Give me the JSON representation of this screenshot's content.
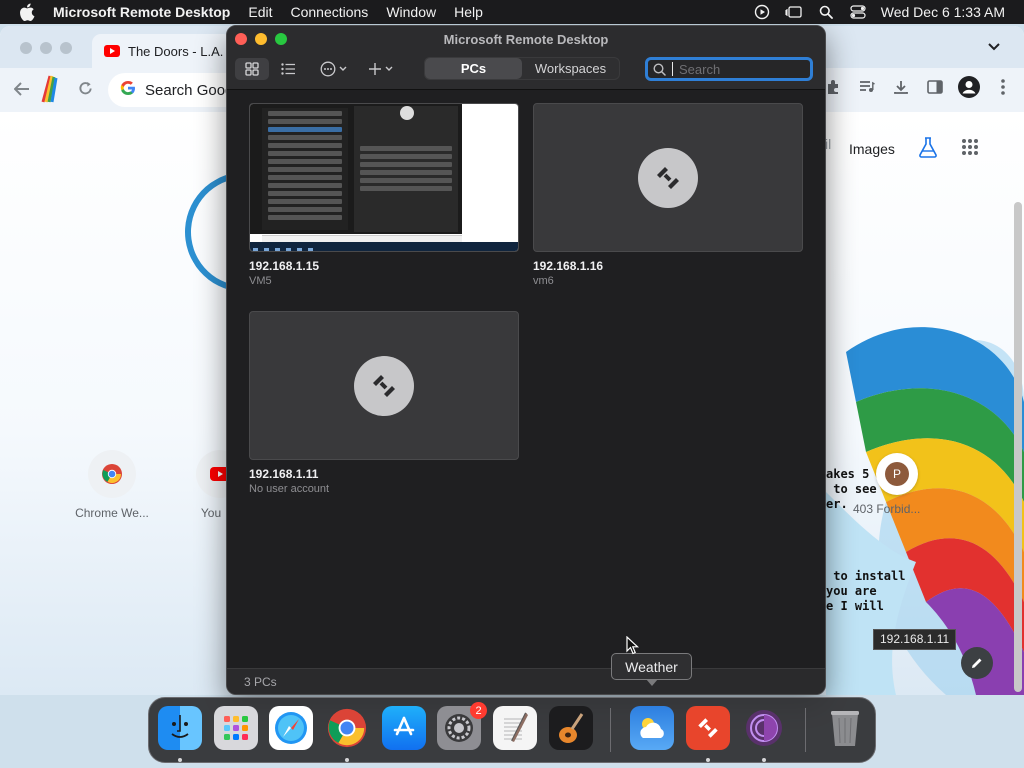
{
  "menubar": {
    "app_name": "Microsoft Remote Desktop",
    "menus": [
      "Edit",
      "Connections",
      "Window",
      "Help"
    ],
    "clock": "Wed Dec 6  1:33 AM"
  },
  "chrome": {
    "tab_title": "The Doors - L.A.",
    "omnibox_placeholder": "Search Goog",
    "links": {
      "faded": "il",
      "images": "Images"
    },
    "shortcuts": [
      {
        "label": "Chrome We..."
      },
      {
        "label": "You"
      }
    ],
    "overlay_text_1": "akes 5 hours\n to see\ner.",
    "overlay_text_2": " to install\nyou are\ne I will",
    "avatar_letter": "P",
    "forbidden_label": "403 Forbid...",
    "tooltip_ip": "192.168.1.11"
  },
  "rdwin": {
    "title": "Microsoft Remote Desktop",
    "tabs": {
      "pcs": "PCs",
      "workspaces": "Workspaces"
    },
    "search_placeholder": "Search",
    "pcs": [
      {
        "name": "192.168.1.15",
        "user": "VM5"
      },
      {
        "name": "192.168.1.16",
        "user": "vm6"
      },
      {
        "name": "192.168.1.11",
        "user": "No user account"
      }
    ],
    "footer_count": "3 PCs"
  },
  "weather_tooltip": "Weather",
  "dock": {
    "apps": [
      "Finder",
      "Launchpad",
      "Safari",
      "Google Chrome",
      "App Store",
      "System Settings",
      "TextEdit",
      "GarageBand",
      "Weather",
      "Microsoft Remote Desktop",
      "Tor Browser",
      "Trash"
    ],
    "settings_badge": "2"
  },
  "colors": {
    "accent_blue": "#2f7fd6",
    "window_bg": "#1f1f21",
    "notification_red": "#ff3b30"
  }
}
